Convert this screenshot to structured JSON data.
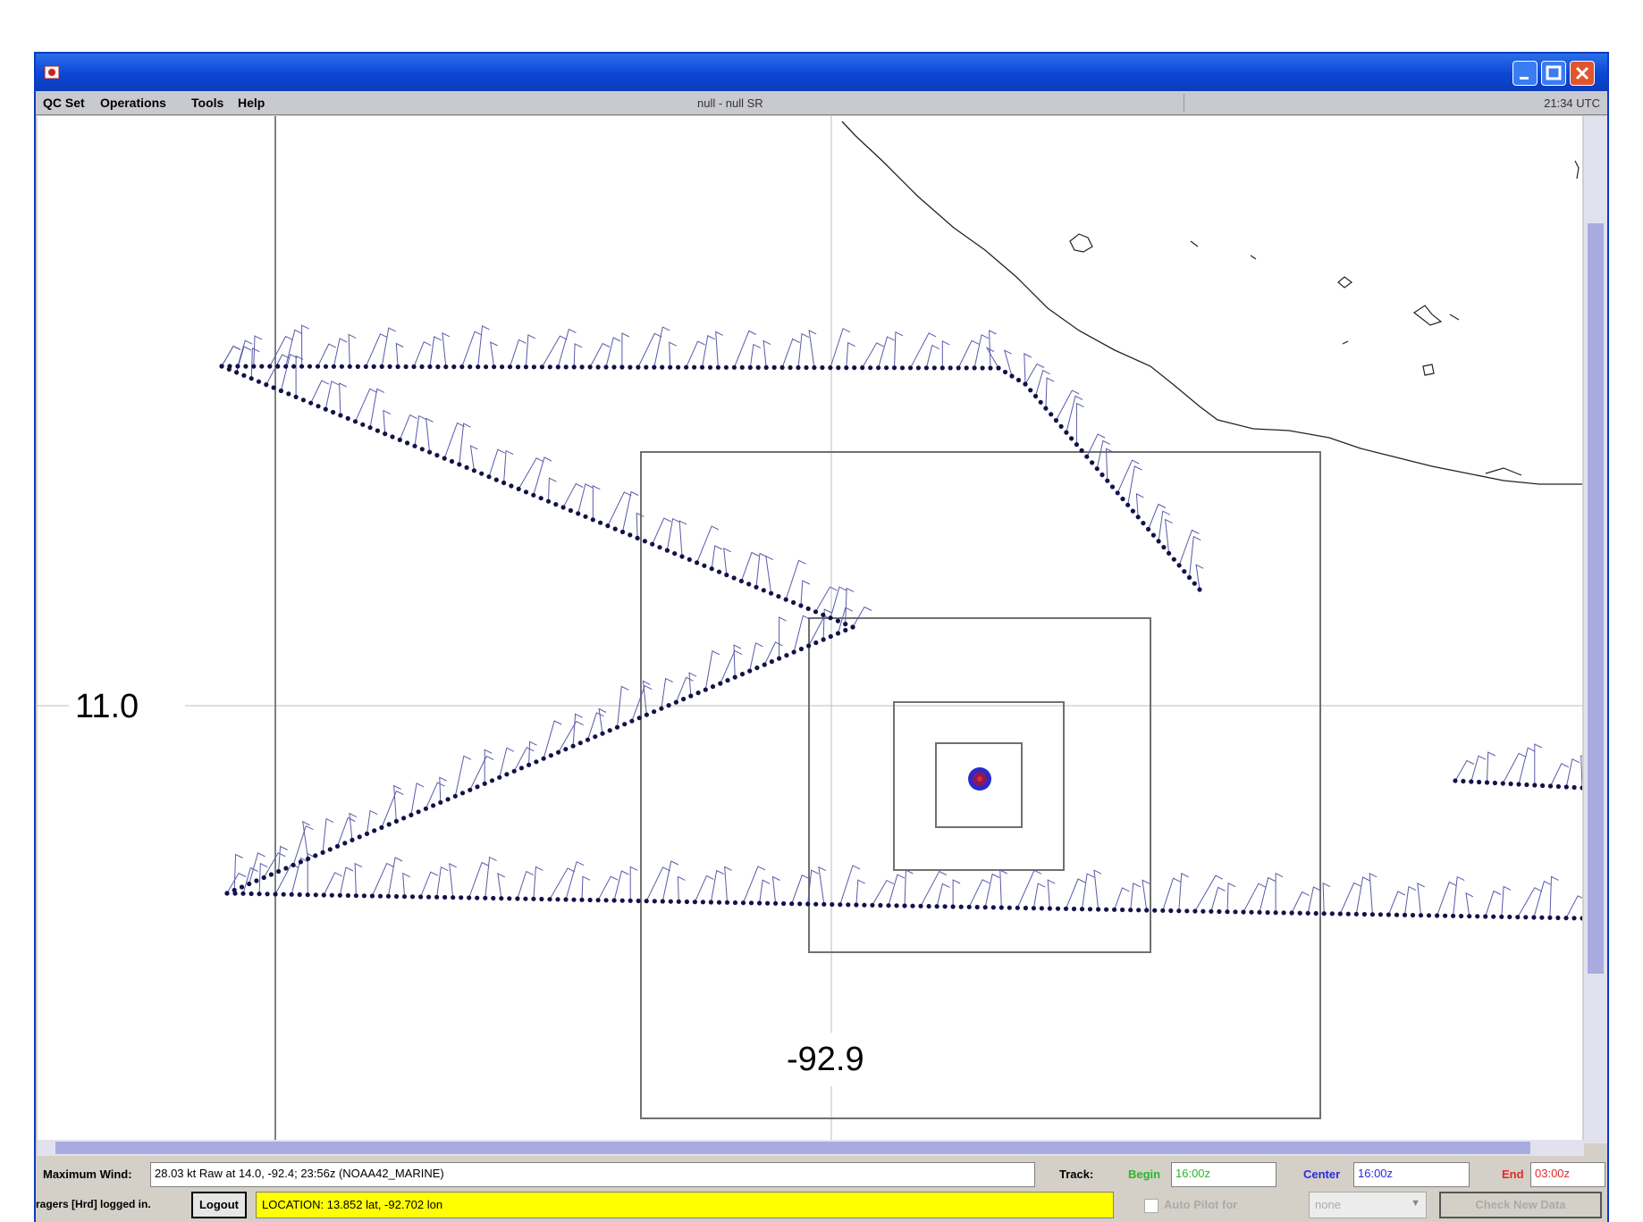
{
  "menu": {
    "items": [
      "QC Set",
      "Operations",
      "Tools",
      "Help"
    ],
    "center_title": "null - null SR",
    "time": "21:34 UTC"
  },
  "map": {
    "lat_label": "11.0",
    "lon_label": "-92.9"
  },
  "status": {
    "max_wind_label": "Maximum Wind:",
    "max_wind_value": "28.03 kt Raw at 14.0, -92.4; 23:56z (NOAA42_MARINE)",
    "track_label": "Track:",
    "begin_label": "Begin",
    "begin_value": "16:00z",
    "center_label": "Center",
    "center_value": "16:00z",
    "end_label": "End",
    "end_value": "03:00z",
    "user_text": "ragers [Hrd] logged in.",
    "logout_label": "Logout",
    "location_text": "LOCATION: 13.852 lat, -92.702 lon",
    "autopilot_label": "Auto Pilot for",
    "select_value": "none",
    "check_new_label": "Check New Data"
  },
  "colors": {
    "titlebar": "#0c46d6",
    "track_dots": "#12124a",
    "wind_barbs": "#5a5aa8",
    "location_bg": "#ffff00",
    "begin": "#2db52d",
    "center": "#2a2ae0",
    "end": "#e02a2a"
  }
}
